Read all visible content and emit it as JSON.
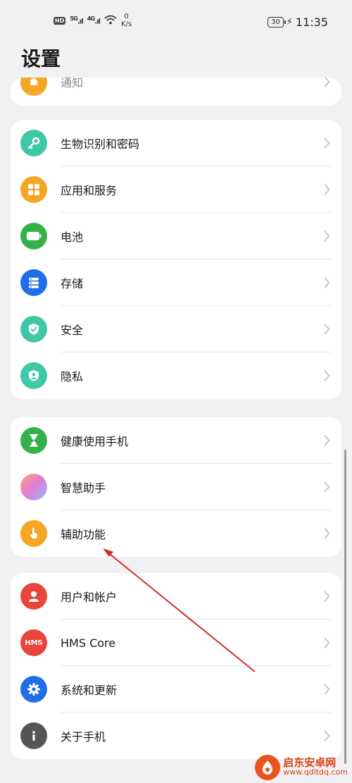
{
  "status_bar": {
    "hd_badge": "HD",
    "sim1": "5G",
    "sim2": "4G",
    "speed_value": "0",
    "speed_unit": "K/s",
    "battery": "30",
    "time": "11:35"
  },
  "page": {
    "title": "设置"
  },
  "top_partial_item": {
    "label": "通知",
    "icon": "bell-icon",
    "color": "#f5a623"
  },
  "group1": [
    {
      "label": "生物识别和密码",
      "icon": "key-icon",
      "color": "#3fc8a6"
    },
    {
      "label": "应用和服务",
      "icon": "grid-icon",
      "color": "#f5a623"
    },
    {
      "label": "电池",
      "icon": "battery-icon",
      "color": "#33b24a"
    },
    {
      "label": "存储",
      "icon": "storage-icon",
      "color": "#1e6ee8"
    },
    {
      "label": "安全",
      "icon": "shield-check-icon",
      "color": "#3fc8a6"
    },
    {
      "label": "隐私",
      "icon": "privacy-icon",
      "color": "#3fc8a6"
    }
  ],
  "group2": [
    {
      "label": "健康使用手机",
      "icon": "hourglass-icon",
      "color": "#33b24a"
    },
    {
      "label": "智慧助手",
      "icon": "assistant-orb-icon",
      "color": "#c77df0"
    },
    {
      "label": "辅助功能",
      "icon": "hand-icon",
      "color": "#f5a623"
    }
  ],
  "group3": [
    {
      "label": "用户和帐户",
      "icon": "user-icon",
      "color": "#e8453c"
    },
    {
      "label": "HMS Core",
      "icon": "hms-icon",
      "color": "#e8453c",
      "icon_text": "HMS"
    },
    {
      "label": "系统和更新",
      "icon": "gear-icon",
      "color": "#1e6ee8"
    },
    {
      "label": "关于手机",
      "icon": "info-icon",
      "color": "#555555"
    }
  ],
  "watermark": {
    "name": "启东安卓网",
    "url": "www.qdltdq.com"
  },
  "colors": {
    "background": "#f1f1f3",
    "card": "#ffffff",
    "annotation_arrow": "#d62b2b"
  }
}
